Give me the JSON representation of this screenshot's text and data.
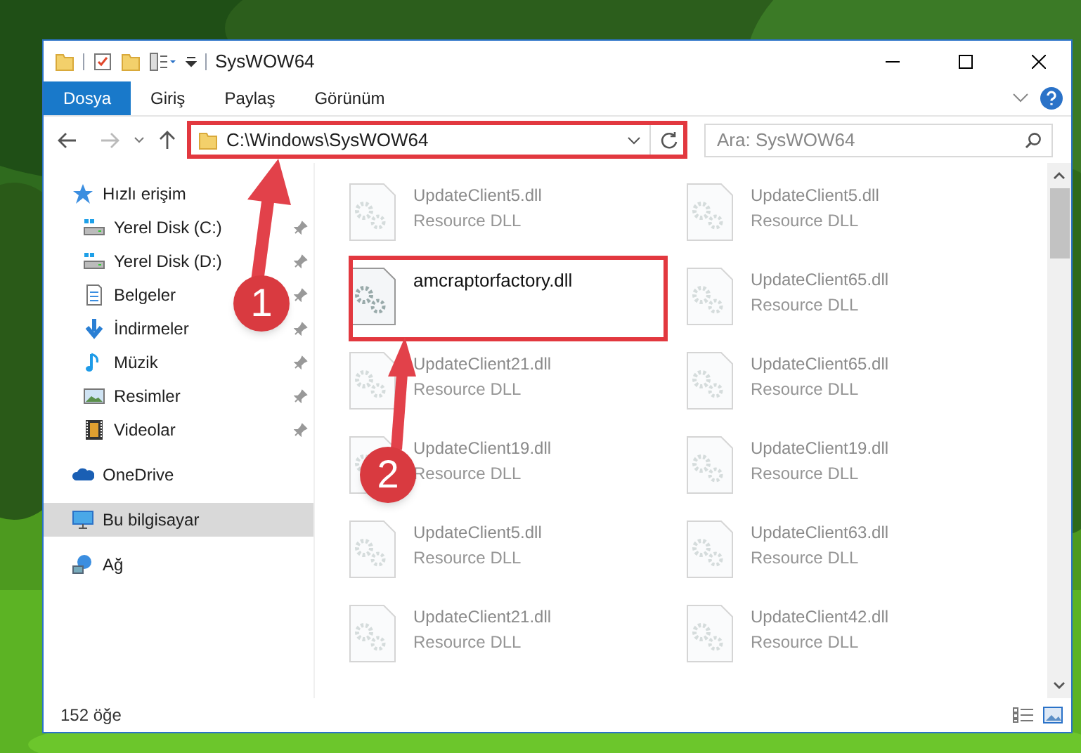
{
  "window": {
    "title": "SysWOW64"
  },
  "ribbon_tabs": [
    {
      "label": "Dosya",
      "selected": true
    },
    {
      "label": "Giriş",
      "selected": false
    },
    {
      "label": "Paylaş",
      "selected": false
    },
    {
      "label": "Görünüm",
      "selected": false
    }
  ],
  "address": {
    "path": "C:\\Windows\\SysWOW64"
  },
  "search": {
    "placeholder": "Ara: SysWOW64"
  },
  "sidebar": {
    "items": [
      {
        "label": "Hızlı erişim",
        "kind": "star",
        "selected": false,
        "children": [
          {
            "label": "Yerel Disk (C:)",
            "kind": "drive",
            "pinned": true,
            "selected": false
          },
          {
            "label": "Yerel Disk (D:)",
            "kind": "drive",
            "pinned": true,
            "selected": false
          },
          {
            "label": "Belgeler",
            "kind": "document",
            "pinned": true,
            "selected": false
          },
          {
            "label": "İndirmeler",
            "kind": "download",
            "pinned": true,
            "selected": false
          },
          {
            "label": "Müzik",
            "kind": "music",
            "pinned": true,
            "selected": false
          },
          {
            "label": "Resimler",
            "kind": "pictures",
            "pinned": true,
            "selected": false
          },
          {
            "label": "Videolar",
            "kind": "video",
            "pinned": true,
            "selected": false
          }
        ]
      },
      {
        "label": "OneDrive",
        "kind": "cloud",
        "selected": false
      },
      {
        "label": "Bu bilgisayar",
        "kind": "computer",
        "selected": true
      },
      {
        "label": "Ağ",
        "kind": "network",
        "selected": false
      }
    ]
  },
  "files": [
    {
      "name": "UpdateClient5.dll",
      "type": "Resource DLL",
      "dimmed": true
    },
    {
      "name": "UpdateClient5.dll",
      "type": "Resource DLL",
      "dimmed": true
    },
    {
      "name": "amcraptorfactory.dll",
      "dimmed": false
    },
    {
      "name": "UpdateClient65.dll",
      "type": "Resource DLL",
      "dimmed": true
    },
    {
      "name": "UpdateClient21.dll",
      "type": "Resource DLL",
      "dimmed": true
    },
    {
      "name": "UpdateClient65.dll",
      "type": "Resource DLL",
      "dimmed": true
    },
    {
      "name": "UpdateClient19.dll",
      "type": "Resource DLL",
      "dimmed": true
    },
    {
      "name": "UpdateClient19.dll",
      "type": "Resource DLL",
      "dimmed": true
    },
    {
      "name": "UpdateClient5.dll",
      "type": "Resource DLL",
      "dimmed": true
    },
    {
      "name": "UpdateClient63.dll",
      "type": "Resource DLL",
      "dimmed": true
    },
    {
      "name": "UpdateClient21.dll",
      "type": "Resource DLL",
      "dimmed": true
    },
    {
      "name": "UpdateClient42.dll",
      "type": "Resource DLL",
      "dimmed": true
    }
  ],
  "status_bar": {
    "count": "152 öğe"
  },
  "annotations": [
    {
      "label": "1"
    },
    {
      "label": "2"
    }
  ]
}
